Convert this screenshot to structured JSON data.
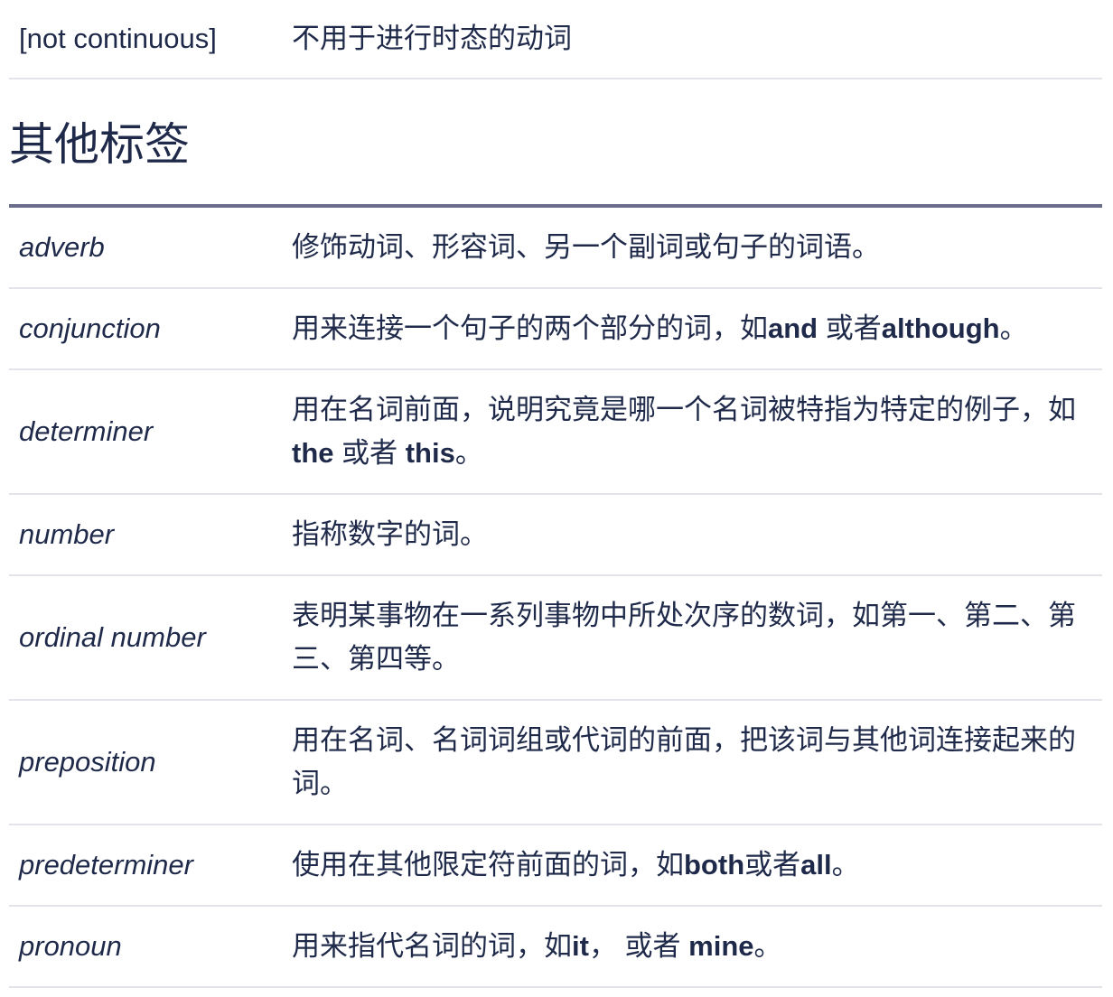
{
  "top_row": {
    "term": "[not continuous]",
    "definition": "不用于进行时态的动词"
  },
  "section": {
    "heading": "其他标签"
  },
  "rows": [
    {
      "term": "adverb",
      "definition": [
        {
          "t": "修饰动词、形容词、另一个副词或句子的词语。",
          "b": false
        }
      ]
    },
    {
      "term": "conjunction",
      "definition": [
        {
          "t": "用来连接一个句子的两个部分的词，如",
          "b": false
        },
        {
          "t": "and",
          "b": true
        },
        {
          "t": " 或者",
          "b": false
        },
        {
          "t": "although",
          "b": true
        },
        {
          "t": "。",
          "b": false
        }
      ]
    },
    {
      "term": "determiner",
      "definition": [
        {
          "t": "用在名词前面，说明究竟是哪一个名词被特指为特定的例子，如",
          "b": false
        },
        {
          "t": "the",
          "b": true
        },
        {
          "t": " 或者 ",
          "b": false
        },
        {
          "t": "this",
          "b": true
        },
        {
          "t": "。",
          "b": false
        }
      ]
    },
    {
      "term": "number",
      "definition": [
        {
          "t": "指称数字的词。",
          "b": false
        }
      ]
    },
    {
      "term": "ordinal number",
      "definition": [
        {
          "t": "表明某事物在一系列事物中所处次序的数词，如第一、第二、第三、第四等。",
          "b": false
        }
      ]
    },
    {
      "term": "preposition",
      "definition": [
        {
          "t": "用在名词、名词词组或代词的前面，把该词与其他词连接起来的词。",
          "b": false
        }
      ]
    },
    {
      "term": "predeterminer",
      "definition": [
        {
          "t": "使用在其他限定符前面的词，如",
          "b": false
        },
        {
          "t": "both",
          "b": true
        },
        {
          "t": "或者",
          "b": false
        },
        {
          "t": "all",
          "b": true
        },
        {
          "t": "。",
          "b": false
        }
      ]
    },
    {
      "term": "pronoun",
      "definition": [
        {
          "t": "用来指代名词的词，如",
          "b": false
        },
        {
          "t": "it",
          "b": true
        },
        {
          "t": "，  或者 ",
          "b": false
        },
        {
          "t": "mine",
          "b": true
        },
        {
          "t": "。",
          "b": false
        }
      ]
    }
  ]
}
